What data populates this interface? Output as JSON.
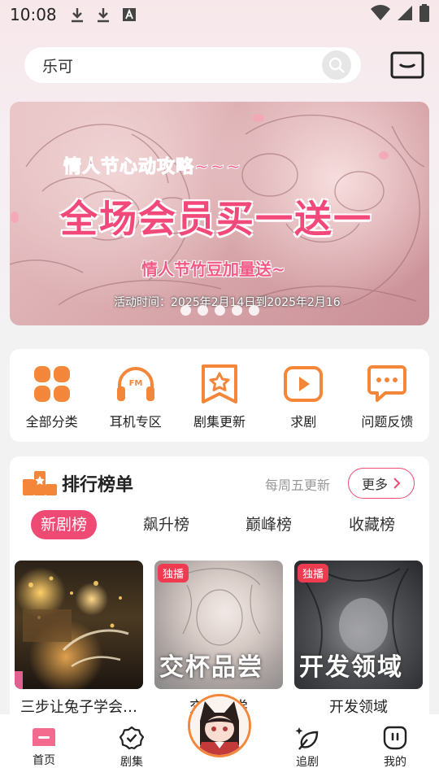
{
  "status_bar": {
    "time": "10:08"
  },
  "search": {
    "value": "乐可"
  },
  "banner": {
    "subtitle": "情人节心动攻略~~~",
    "title": "全场会员买一送一",
    "subtitle2": "情人节竹豆加量送~",
    "date_text": "活动时间：2025年2月14日到2025年2月16",
    "dot_count": 5
  },
  "quick_actions": [
    {
      "label": "全部分类",
      "icon": "grid-icon"
    },
    {
      "label": "耳机专区",
      "icon": "headphones-fm-icon"
    },
    {
      "label": "剧集更新",
      "icon": "bookmark-star-icon"
    },
    {
      "label": "求剧",
      "icon": "play-box-icon"
    },
    {
      "label": "问题反馈",
      "icon": "chat-dots-icon"
    }
  ],
  "ranking": {
    "title": "排行榜单",
    "update_note": "每周五更新",
    "more_label": "更多",
    "tabs": [
      "新剧榜",
      "飙升榜",
      "巅峰榜",
      "收藏榜"
    ],
    "active_tab": 0,
    "items": [
      {
        "name": "三步让兔子学会…",
        "badge": "",
        "cover_text": ""
      },
      {
        "name": "交杯品尝",
        "badge": "独播",
        "cover_text": "交杯品尝"
      },
      {
        "name": "开发领域",
        "badge": "独播",
        "cover_text": "开发领域"
      }
    ]
  },
  "bottom_nav": [
    {
      "label": "首页",
      "icon": "home-icon"
    },
    {
      "label": "剧集",
      "icon": "badge-check-icon"
    },
    {
      "label": "追剧",
      "icon": "leaf-sparkle-icon"
    },
    {
      "label": "我的",
      "icon": "face-icon"
    }
  ],
  "colors": {
    "accent": "#ef4a73",
    "orange": "#f4863a"
  }
}
